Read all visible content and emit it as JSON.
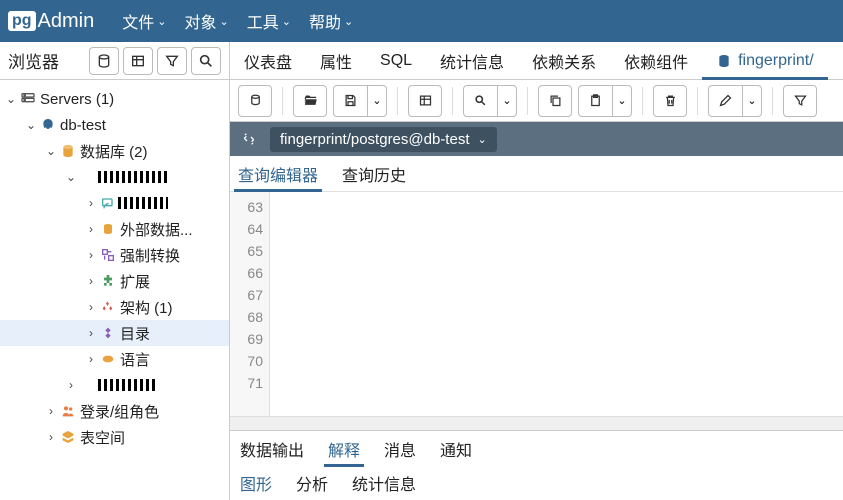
{
  "brand": {
    "prefix": "pg",
    "name": "Admin"
  },
  "menu": [
    "文件",
    "对象",
    "工具",
    "帮助"
  ],
  "sidebar": {
    "title": "浏览器",
    "tree": {
      "servers": "Servers (1)",
      "dbtest": "db-test",
      "databases": "数据库  (2)",
      "extdata": "外部数据...",
      "cast": "强制转换",
      "ext": "扩展",
      "schema": "架构 (1)",
      "catalog": "目录",
      "lang": "语言",
      "login": "登录/组角色",
      "tablespace": "表空间"
    }
  },
  "tabs": [
    "仪表盘",
    "属性",
    "SQL",
    "统计信息",
    "依赖关系",
    "依赖组件",
    "fingerprint/"
  ],
  "path": "fingerprint/postgres@db-test",
  "subtabs": {
    "editor": "查询编辑器",
    "history": "查询历史"
  },
  "lines": [
    "63",
    "64",
    "65",
    "66",
    "67",
    "68",
    "69",
    "70",
    "71"
  ],
  "bottom": [
    "数据输出",
    "解释",
    "消息",
    "通知"
  ],
  "explain": [
    "图形",
    "分析",
    "统计信息"
  ]
}
